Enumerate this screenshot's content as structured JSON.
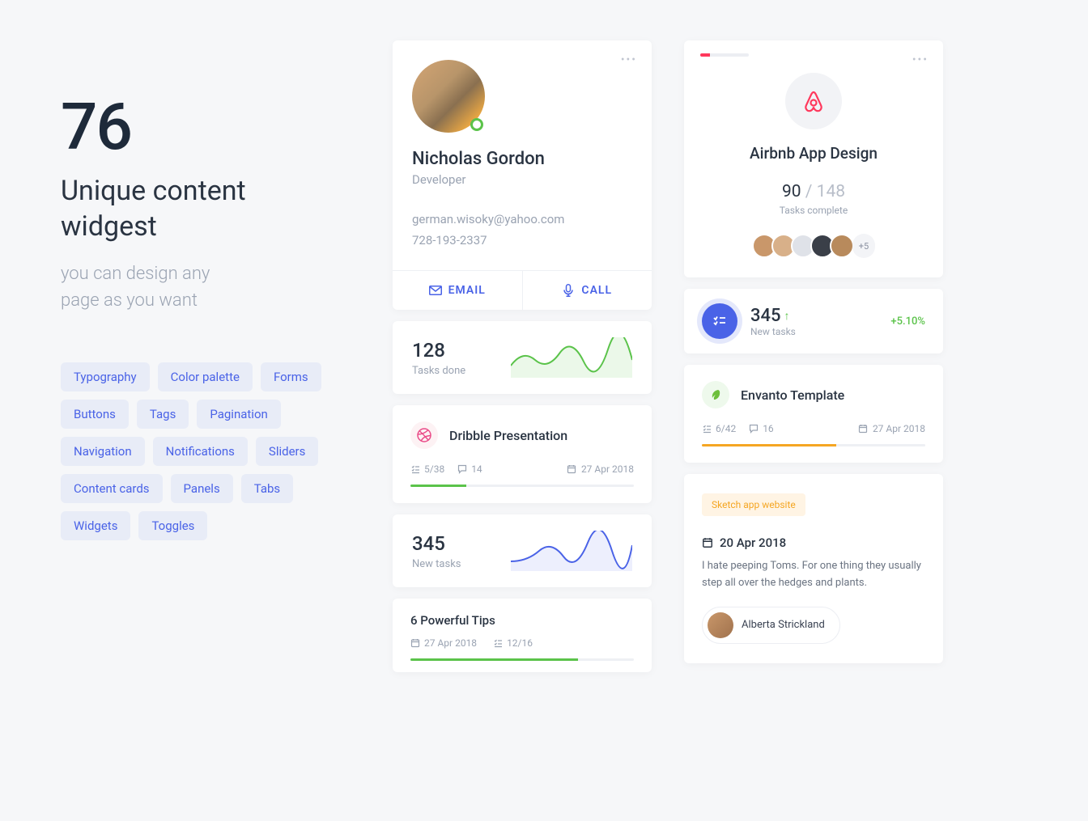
{
  "intro": {
    "number": "76",
    "title_l1": "Unique content",
    "title_l2": "widgest",
    "sub_l1": "you can design any",
    "sub_l2": "page as you want"
  },
  "tags": [
    "Typography",
    "Color palette",
    "Forms",
    "Buttons",
    "Tags",
    "Pagination",
    "Navigation",
    "Notifications",
    "Sliders",
    "Content cards",
    "Panels",
    "Tabs",
    "Widgets",
    "Toggles"
  ],
  "profile": {
    "name": "Nicholas Gordon",
    "role": "Developer",
    "email": "german.wisoky@yahoo.com",
    "phone": "728-193-2337",
    "email_btn": "EMAIL",
    "call_btn": "CALL"
  },
  "tasks_done": {
    "value": "128",
    "label": "Tasks done"
  },
  "dribble": {
    "title": "Dribble Presentation",
    "tasks": "5/38",
    "comments": "14",
    "date": "27 Apr 2018",
    "barColor": "#5bc34a",
    "barPct": 25
  },
  "new_tasks_chart": {
    "value": "345",
    "label": "New tasks"
  },
  "tips": {
    "title": "6 Powerful Tips",
    "date": "27 Apr 2018",
    "tasks": "12/16"
  },
  "airbnb": {
    "title": "Airbnb App Design",
    "done": "90",
    "sep": " / ",
    "total": "148",
    "label": "Tasks complete",
    "more": "+5"
  },
  "nt": {
    "value": "345",
    "label": "New tasks",
    "pct": "+5.10%"
  },
  "envanto": {
    "title": "Envanto Template",
    "tasks": "6/42",
    "comments": "16",
    "date": "27 Apr 2018"
  },
  "sketch": {
    "chip": "Sketch app website",
    "date": "20 Apr 2018",
    "para": "I hate peeping Toms. For one thing they usually step all over the hedges and plants.",
    "author": "Alberta Strickland"
  },
  "avatar_colors": [
    "#c9976a",
    "#d8b089",
    "#dfe2e8",
    "#3a3f48",
    "#b88a5c"
  ]
}
